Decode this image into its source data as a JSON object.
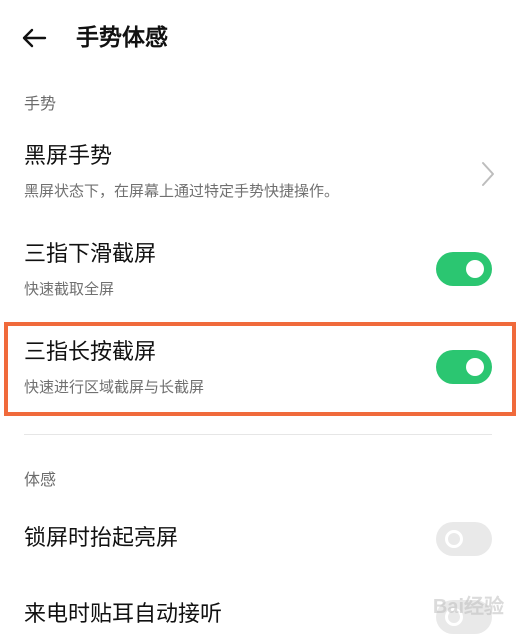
{
  "header": {
    "title": "手势体感"
  },
  "sections": {
    "gestures_title": "手势",
    "motion_title": "体感"
  },
  "rows": {
    "black_screen": {
      "title": "黑屏手势",
      "desc": "黑屏状态下，在屏幕上通过特定手势快捷操作。"
    },
    "three_finger_swipe": {
      "title": "三指下滑截屏",
      "desc": "快速截取全屏",
      "enabled": true
    },
    "three_finger_hold": {
      "title": "三指长按截屏",
      "desc": "快速进行区域截屏与长截屏",
      "enabled": true
    },
    "raise_to_wake": {
      "title": "锁屏时抬起亮屏",
      "enabled": false
    },
    "auto_answer": {
      "title": "来电时贴耳自动接听",
      "enabled": false
    }
  },
  "watermark": "Bai经验",
  "colors": {
    "toggle_on": "#2bc671",
    "toggle_off": "#e9e9e9",
    "highlight": "#f06a3b"
  }
}
